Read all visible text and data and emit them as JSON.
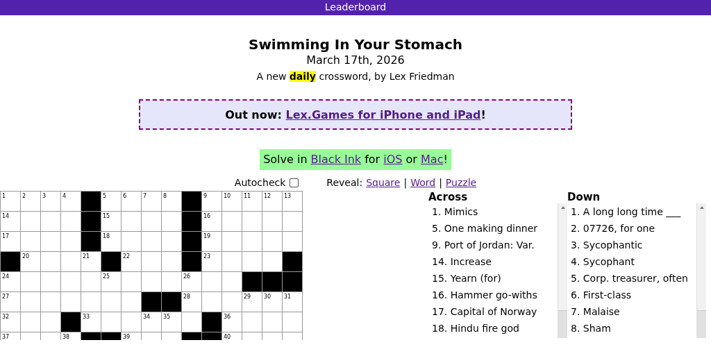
{
  "header": {
    "link": "Leaderboard"
  },
  "title": "Swimming In Your Stomach",
  "date": "March 17th, 2026",
  "byline": "A new **daily** crossword, by Lex Friedman",
  "banner": {
    "parts": [
      {
        "kind": "bold",
        "text": "Out now: "
      },
      {
        "kind": "link",
        "text": "Lex.Games for iPhone and iPad"
      },
      {
        "kind": "bold",
        "text": "!"
      }
    ]
  },
  "solve_note": {
    "parts": [
      {
        "kind": "text",
        "text": "Solve in "
      },
      {
        "kind": "link",
        "text": "Black Ink"
      },
      {
        "kind": "text",
        "text": " for "
      },
      {
        "kind": "link",
        "text": "iOS"
      },
      {
        "kind": "text",
        "text": " or "
      },
      {
        "kind": "link",
        "text": "Mac"
      },
      {
        "kind": "text",
        "text": "!"
      }
    ]
  },
  "controls": {
    "autocheck": {
      "label": "Autocheck",
      "checked": false
    },
    "reveal": {
      "label": "Reveal:",
      "links": [
        "Square",
        "Word",
        "Puzzle"
      ],
      "separator": "|"
    }
  },
  "grid": {
    "rows": [
      [
        {
          "kind": "open",
          "number": "1"
        },
        {
          "kind": "open",
          "number": "2"
        },
        {
          "kind": "open",
          "number": "3"
        },
        {
          "kind": "open",
          "number": "4"
        },
        {
          "kind": "block"
        },
        {
          "kind": "open",
          "number": "5"
        },
        {
          "kind": "open",
          "number": "6"
        },
        {
          "kind": "open",
          "number": "7"
        },
        {
          "kind": "open",
          "number": "8"
        },
        {
          "kind": "block"
        },
        {
          "kind": "open",
          "number": "9"
        },
        {
          "kind": "open",
          "number": "10"
        },
        {
          "kind": "open",
          "number": "11"
        },
        {
          "kind": "open",
          "number": "12"
        },
        {
          "kind": "open",
          "number": "13"
        }
      ],
      [
        {
          "kind": "open",
          "number": "14"
        },
        {
          "kind": "open"
        },
        {
          "kind": "open"
        },
        {
          "kind": "open"
        },
        {
          "kind": "block"
        },
        {
          "kind": "open",
          "number": "15"
        },
        {
          "kind": "open"
        },
        {
          "kind": "open"
        },
        {
          "kind": "open"
        },
        {
          "kind": "block"
        },
        {
          "kind": "open",
          "number": "16"
        },
        {
          "kind": "open"
        },
        {
          "kind": "open"
        },
        {
          "kind": "open"
        },
        {
          "kind": "open"
        }
      ],
      [
        {
          "kind": "open",
          "number": "17"
        },
        {
          "kind": "open"
        },
        {
          "kind": "open"
        },
        {
          "kind": "open"
        },
        {
          "kind": "block"
        },
        {
          "kind": "open",
          "number": "18"
        },
        {
          "kind": "open"
        },
        {
          "kind": "open"
        },
        {
          "kind": "open"
        },
        {
          "kind": "block"
        },
        {
          "kind": "open",
          "number": "19"
        },
        {
          "kind": "open"
        },
        {
          "kind": "open"
        },
        {
          "kind": "open"
        },
        {
          "kind": "open"
        }
      ],
      [
        {
          "kind": "block"
        },
        {
          "kind": "open",
          "number": "20"
        },
        {
          "kind": "open"
        },
        {
          "kind": "open"
        },
        {
          "kind": "open",
          "number": "21"
        },
        {
          "kind": "block"
        },
        {
          "kind": "open",
          "number": "22"
        },
        {
          "kind": "open"
        },
        {
          "kind": "open"
        },
        {
          "kind": "block"
        },
        {
          "kind": "open",
          "number": "23"
        },
        {
          "kind": "open"
        },
        {
          "kind": "open"
        },
        {
          "kind": "open"
        },
        {
          "kind": "block"
        }
      ],
      [
        {
          "kind": "open",
          "number": "24"
        },
        {
          "kind": "open"
        },
        {
          "kind": "open"
        },
        {
          "kind": "open"
        },
        {
          "kind": "open"
        },
        {
          "kind": "open",
          "number": "25"
        },
        {
          "kind": "open"
        },
        {
          "kind": "open"
        },
        {
          "kind": "open"
        },
        {
          "kind": "open",
          "number": "26"
        },
        {
          "kind": "open"
        },
        {
          "kind": "open"
        },
        {
          "kind": "block"
        },
        {
          "kind": "block"
        },
        {
          "kind": "block"
        }
      ],
      [
        {
          "kind": "open",
          "number": "27"
        },
        {
          "kind": "open"
        },
        {
          "kind": "open"
        },
        {
          "kind": "open"
        },
        {
          "kind": "open"
        },
        {
          "kind": "open"
        },
        {
          "kind": "open"
        },
        {
          "kind": "block"
        },
        {
          "kind": "block"
        },
        {
          "kind": "open",
          "number": "28"
        },
        {
          "kind": "open"
        },
        {
          "kind": "open"
        },
        {
          "kind": "open",
          "number": "29"
        },
        {
          "kind": "open",
          "number": "30"
        },
        {
          "kind": "open",
          "number": "31"
        }
      ],
      [
        {
          "kind": "open",
          "number": "32"
        },
        {
          "kind": "open"
        },
        {
          "kind": "open"
        },
        {
          "kind": "block"
        },
        {
          "kind": "open",
          "number": "33"
        },
        {
          "kind": "open"
        },
        {
          "kind": "open"
        },
        {
          "kind": "open",
          "number": "34"
        },
        {
          "kind": "open",
          "number": "35"
        },
        {
          "kind": "open"
        },
        {
          "kind": "block"
        },
        {
          "kind": "open",
          "number": "36"
        },
        {
          "kind": "open"
        },
        {
          "kind": "open"
        },
        {
          "kind": "open"
        }
      ],
      [
        {
          "kind": "open",
          "number": "37"
        },
        {
          "kind": "open"
        },
        {
          "kind": "open"
        },
        {
          "kind": "open",
          "number": "38"
        },
        {
          "kind": "block"
        },
        {
          "kind": "block"
        },
        {
          "kind": "open",
          "number": "39"
        },
        {
          "kind": "open"
        },
        {
          "kind": "open"
        },
        {
          "kind": "block"
        },
        {
          "kind": "block"
        },
        {
          "kind": "open",
          "number": "40"
        },
        {
          "kind": "open"
        },
        {
          "kind": "open"
        },
        {
          "kind": "open"
        }
      ]
    ]
  },
  "clues": [
    {
      "heading": "Across",
      "items": [
        "1. Mimics",
        "5. One making dinner",
        "9. Port of Jordan: Var.",
        "14. Increase",
        "15. Yearn (for)",
        "16. Hammer go-withs",
        "17. Capital of Norway",
        "18. Hindu fire god"
      ]
    },
    {
      "heading": "Down",
      "items": [
        "1. A long long time ___",
        "2. 07726, for one",
        "3. Sycophantic",
        "4. Sycophant",
        "5. Corp. treasurer, often",
        "6. First-class",
        "7. Malaise",
        "8. Sham"
      ]
    }
  ]
}
